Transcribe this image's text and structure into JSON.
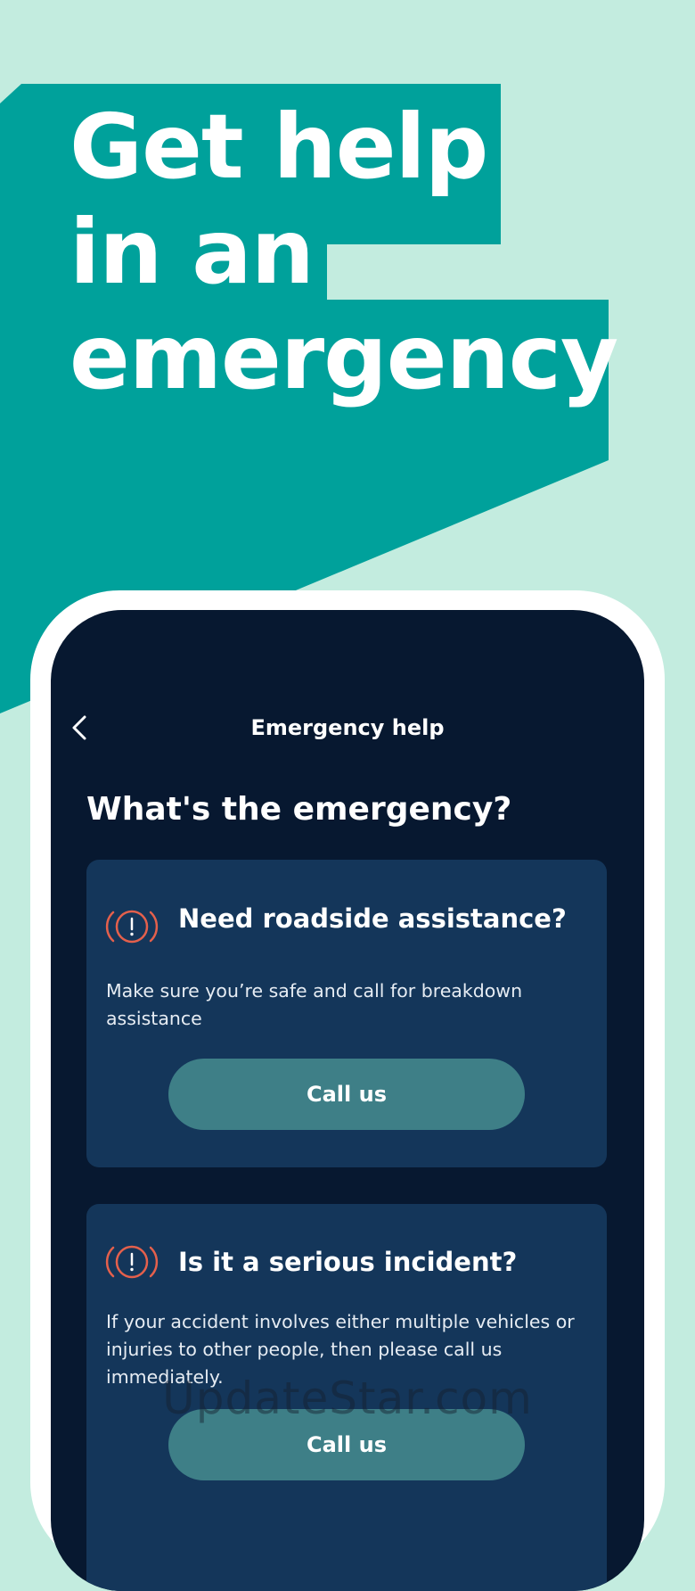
{
  "banner": {
    "headline_lines": [
      "Get help",
      "in an",
      "emergency"
    ]
  },
  "screen": {
    "nav": {
      "back_icon": "chevron-left-icon",
      "title": "Emergency help"
    },
    "question": "What's the emergency?",
    "cards": [
      {
        "icon": "alert-circle-icon",
        "title": "Need roadside assistance?",
        "description": "Make sure you’re safe and call for breakdown assistance",
        "button_label": "Call us"
      },
      {
        "icon": "alert-circle-icon",
        "title": "Is it a serious incident?",
        "description": "If your accident involves either multiple vehicles or injuries to other people, then please call us immediately.",
        "button_label": "Call us"
      }
    ]
  },
  "watermark": "UpdateStar.com",
  "colors": {
    "page_background": "#c3ecdf",
    "banner_teal": "#00a19b",
    "screen_background": "#071830",
    "card_background": "#14365a",
    "button_background": "#3e7f87",
    "alert_icon": "#e4604c"
  }
}
